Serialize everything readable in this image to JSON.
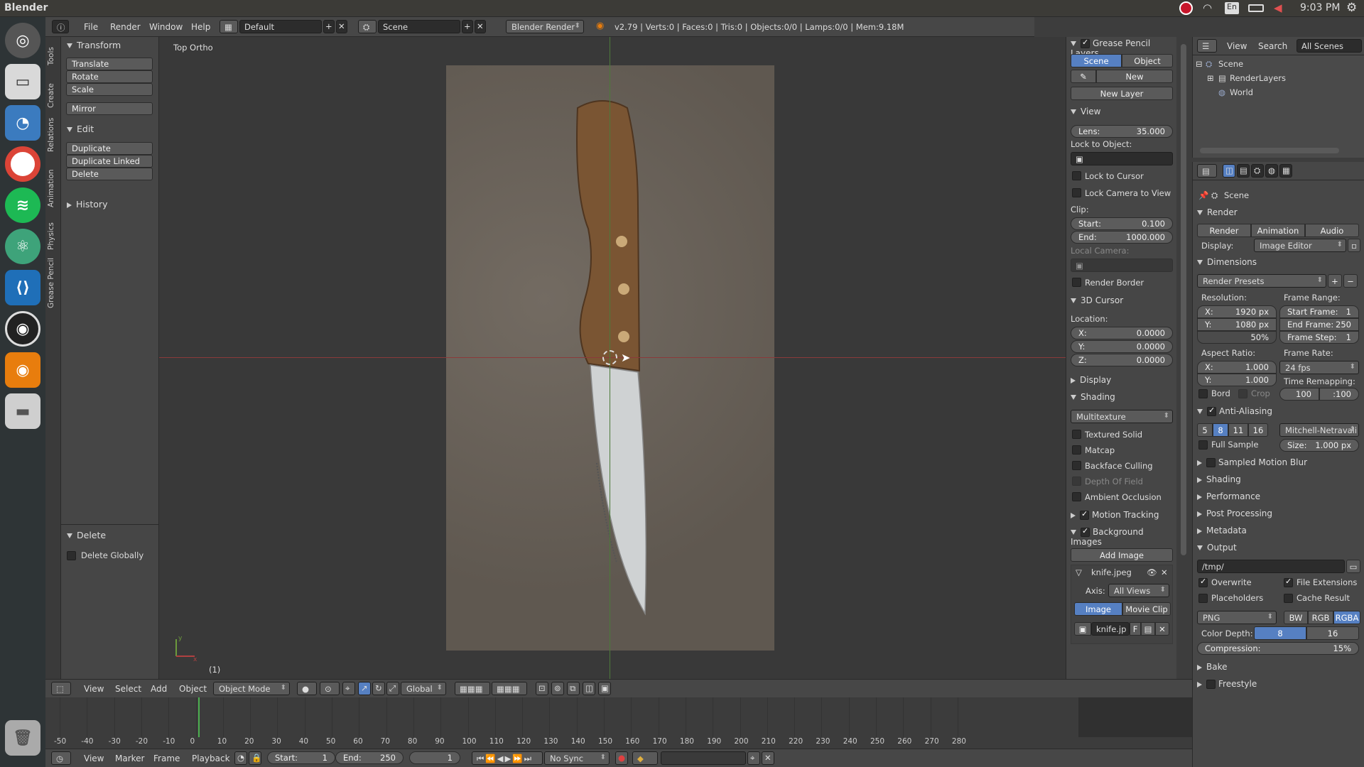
{
  "os": {
    "app_name": "Blender",
    "time": "9:03 PM",
    "lang": "En"
  },
  "menu": {
    "file": "File",
    "render": "Render",
    "window": "Window",
    "help": "Help",
    "layout": "Default",
    "scene": "Scene",
    "engine": "Blender Render",
    "stats": "v2.79 | Verts:0 | Faces:0 | Tris:0 | Objects:0/0 | Lamps:0/0 | Mem:9.18M"
  },
  "vtabs": [
    "Tools",
    "Create",
    "Relations",
    "Animation",
    "Physics",
    "Grease Pencil"
  ],
  "tools": {
    "transform": "Transform",
    "translate": "Translate",
    "rotate": "Rotate",
    "scale": "Scale",
    "mirror": "Mirror",
    "edit": "Edit",
    "duplicate": "Duplicate",
    "duplicate_linked": "Duplicate Linked",
    "delete": "Delete",
    "history": "History",
    "op_delete": "Delete",
    "delete_globally": "Delete Globally"
  },
  "viewport": {
    "label": "Top Ortho",
    "frame": "(1)",
    "axis_y": "y",
    "axis_x": "x"
  },
  "npanel": {
    "gp_layers": "Grease Pencil Layers",
    "scene": "Scene",
    "object": "Object",
    "new": "New",
    "new_layer": "New Layer",
    "view": "View",
    "lens_label": "Lens:",
    "lens_value": "35.000",
    "lock_to_object": "Lock to Object:",
    "lock_to_cursor": "Lock to Cursor",
    "lock_camera": "Lock Camera to View",
    "clip": "Clip:",
    "clip_start_label": "Start:",
    "clip_start": "0.100",
    "clip_end_label": "End:",
    "clip_end": "1000.000",
    "local_camera": "Local Camera:",
    "render_border": "Render Border",
    "cursor_3d": "3D Cursor",
    "location": "Location:",
    "x_label": "X:",
    "x": "0.0000",
    "y_label": "Y:",
    "y": "0.0000",
    "z_label": "Z:",
    "z": "0.0000",
    "display": "Display",
    "shading": "Shading",
    "shading_mode": "Multitexture",
    "textured_solid": "Textured Solid",
    "matcap": "Matcap",
    "backface": "Backface Culling",
    "dof": "Depth Of Field",
    "ao": "Ambient Occlusion",
    "motion_tracking": "Motion Tracking",
    "background_images": "Background Images",
    "add_image": "Add Image",
    "image_name": "knife.jpeg",
    "axis_label": "Axis:",
    "axis_value": "All Views",
    "image": "Image",
    "movie_clip": "Movie Clip",
    "image_field": "knife.jp",
    "f": "F"
  },
  "outliner": {
    "view": "View",
    "search": "Search",
    "all_scenes": "All Scenes",
    "scene": "Scene",
    "render_layers": "RenderLayers",
    "world": "World"
  },
  "props": {
    "scene": "Scene",
    "render": "Render",
    "render_btn": "Render",
    "animation_btn": "Animation",
    "audio_btn": "Audio",
    "display_label": "Display:",
    "display_value": "Image Editor",
    "dimensions": "Dimensions",
    "render_presets": "Render Presets",
    "resolution": "Resolution:",
    "res_x_label": "X:",
    "res_x": "1920 px",
    "res_y_label": "Y:",
    "res_y": "1080 px",
    "res_pct": "50%",
    "frame_range": "Frame Range:",
    "start_frame_label": "Start Frame:",
    "start_frame": "1",
    "end_frame_label": "End Frame:",
    "end_frame": "250",
    "frame_step_label": "Frame Step:",
    "frame_step": "1",
    "aspect_ratio": "Aspect Ratio:",
    "asp_x_label": "X:",
    "asp_x": "1.000",
    "asp_y_label": "Y:",
    "asp_y": "1.000",
    "frame_rate": "Frame Rate:",
    "fps": "24 fps",
    "time_remapping": "Time Remapping:",
    "remap_old": "100",
    "remap_new": ":100",
    "bord": "Bord",
    "crop": "Crop",
    "anti_aliasing": "Anti-Aliasing",
    "aa_5": "5",
    "aa_8": "8",
    "aa_11": "11",
    "aa_16": "16",
    "aa_filter": "Mitchell-Netravali",
    "full_sample": "Full Sample",
    "size_label": "Size:",
    "size_value": "1.000 px",
    "motion_blur": "Sampled Motion Blur",
    "shading": "Shading",
    "performance": "Performance",
    "post_processing": "Post Processing",
    "metadata": "Metadata",
    "output": "Output",
    "output_path": "/tmp/",
    "overwrite": "Overwrite",
    "file_extensions": "File Extensions",
    "placeholders": "Placeholders",
    "cache_result": "Cache Result",
    "format": "PNG",
    "bw": "BW",
    "rgb": "RGB",
    "rgba": "RGBA",
    "color_depth_label": "Color Depth:",
    "cd_8": "8",
    "cd_16": "16",
    "compression_label": "Compression:",
    "compression": "15%",
    "bake": "Bake",
    "freestyle": "Freestyle"
  },
  "vpfoot": {
    "view": "View",
    "select": "Select",
    "add": "Add",
    "object": "Object",
    "mode": "Object Mode",
    "orientation": "Global"
  },
  "timeline": {
    "ticks": [
      "-50",
      "-40",
      "-30",
      "-20",
      "-10",
      "0",
      "10",
      "20",
      "30",
      "40",
      "50",
      "60",
      "70",
      "80",
      "90",
      "100",
      "110",
      "120",
      "130",
      "140",
      "150",
      "160",
      "170",
      "180",
      "190",
      "200",
      "210",
      "220",
      "230",
      "240",
      "250",
      "260",
      "270",
      "280"
    ],
    "current": 1
  },
  "tlfoot": {
    "view": "View",
    "marker": "Marker",
    "frame": "Frame",
    "playback": "Playback",
    "start_label": "Start:",
    "start": "1",
    "end_label": "End:",
    "end": "250",
    "current": "1",
    "sync": "No Sync"
  }
}
